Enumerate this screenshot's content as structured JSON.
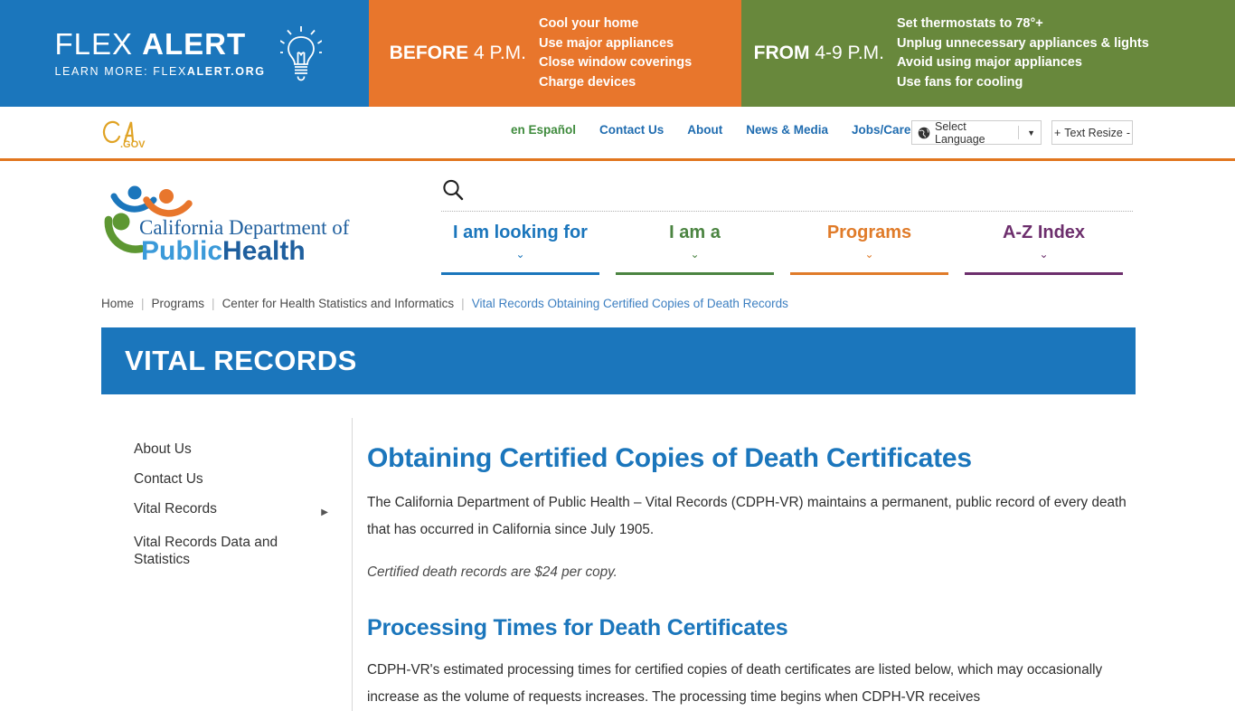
{
  "flex_alert": {
    "title_light": "FLEX",
    "title_bold": "ALERT",
    "subtitle_prefix": "LEARN MORE: FLEX",
    "subtitle_bold": "ALERT.ORG",
    "bulb_icon": "lightbulb-icon",
    "blue_color": "#1b76bc",
    "orange_color": "#e8762c",
    "green_color": "#68883c",
    "before": {
      "when_bold": "BEFORE",
      "when_thin": "4 P.M.",
      "items": [
        "Cool your home",
        "Use major appliances",
        "Close window coverings",
        "Charge devices"
      ]
    },
    "from": {
      "when_bold": "FROM",
      "when_thin": "4-9 P.M.",
      "items": [
        "Set thermostats to 78°+",
        "Unplug unnecessary appliances & lights",
        "Avoid using major appliances",
        "Use fans for cooling"
      ]
    }
  },
  "ca_bar": {
    "logo": "ca-gov-logo",
    "links": [
      {
        "label": "en Español",
        "style": "es"
      },
      {
        "label": "Contact Us",
        "style": ""
      },
      {
        "label": "About",
        "style": ""
      },
      {
        "label": "News & Media",
        "style": ""
      },
      {
        "label": "Jobs/Careers",
        "style": ""
      }
    ],
    "language_selector": {
      "icon": "globe-icon",
      "label": "Select Language",
      "caret": "▼"
    },
    "text_resize": {
      "plus": "+",
      "label": "Text Resize",
      "minus": "-"
    }
  },
  "cdph_header": {
    "logo": {
      "line1": "California Department of",
      "line2_light": "Public",
      "line2_dark": "Health"
    },
    "search_icon": "search-icon",
    "nav": [
      {
        "label": "I am looking for",
        "color_class": "c-blue",
        "bar_class": "bg-blue",
        "chevron": "⌄"
      },
      {
        "label": "I am a",
        "color_class": "c-green",
        "bar_class": "bg-green",
        "chevron": "⌄"
      },
      {
        "label": "Programs",
        "color_class": "c-orange",
        "bar_class": "bg-orange",
        "chevron": "⌄"
      },
      {
        "label": "A-Z Index",
        "color_class": "c-purple",
        "bar_class": "bg-purple",
        "chevron": "⌄"
      }
    ]
  },
  "breadcrumb": {
    "items": [
      {
        "label": "Home",
        "current": false
      },
      {
        "label": "Programs",
        "current": false
      },
      {
        "label": "Center for Health Statistics and Informatics",
        "current": false
      },
      {
        "label": "Vital Records Obtaining Certified Copies of Death Records",
        "current": true
      }
    ],
    "separator": "|"
  },
  "page_banner": {
    "title": "VITAL RECORDS",
    "color": "#1b76bc"
  },
  "sidebar": {
    "items": [
      {
        "label": "About Us",
        "has_arrow": false,
        "arrow": ""
      },
      {
        "label": "Contact Us",
        "has_arrow": false,
        "arrow": ""
      },
      {
        "label": "Vital Records",
        "has_arrow": true,
        "arrow": "▶"
      },
      {
        "label": "Vital Records Data and Statistics",
        "has_arrow": false,
        "arrow": ""
      }
    ]
  },
  "content": {
    "heading": "Obtaining Certified Copies of Death Certificates",
    "paragraph1": "The California Department of Public Health – Vital Records (CDPH-VR) maintains a permanent, public record of every death that has occurred in California since July 1905.",
    "paragraph2": "Certified death records are $24 per copy.",
    "subheading": "Processing Times for Death Certificates",
    "paragraph3": "CDPH-VR's estimated processing times for certified copies of death certificates are listed below, which may occasionally increase as the volume of requests increases. The processing time begins when CDPH-VR receives"
  }
}
